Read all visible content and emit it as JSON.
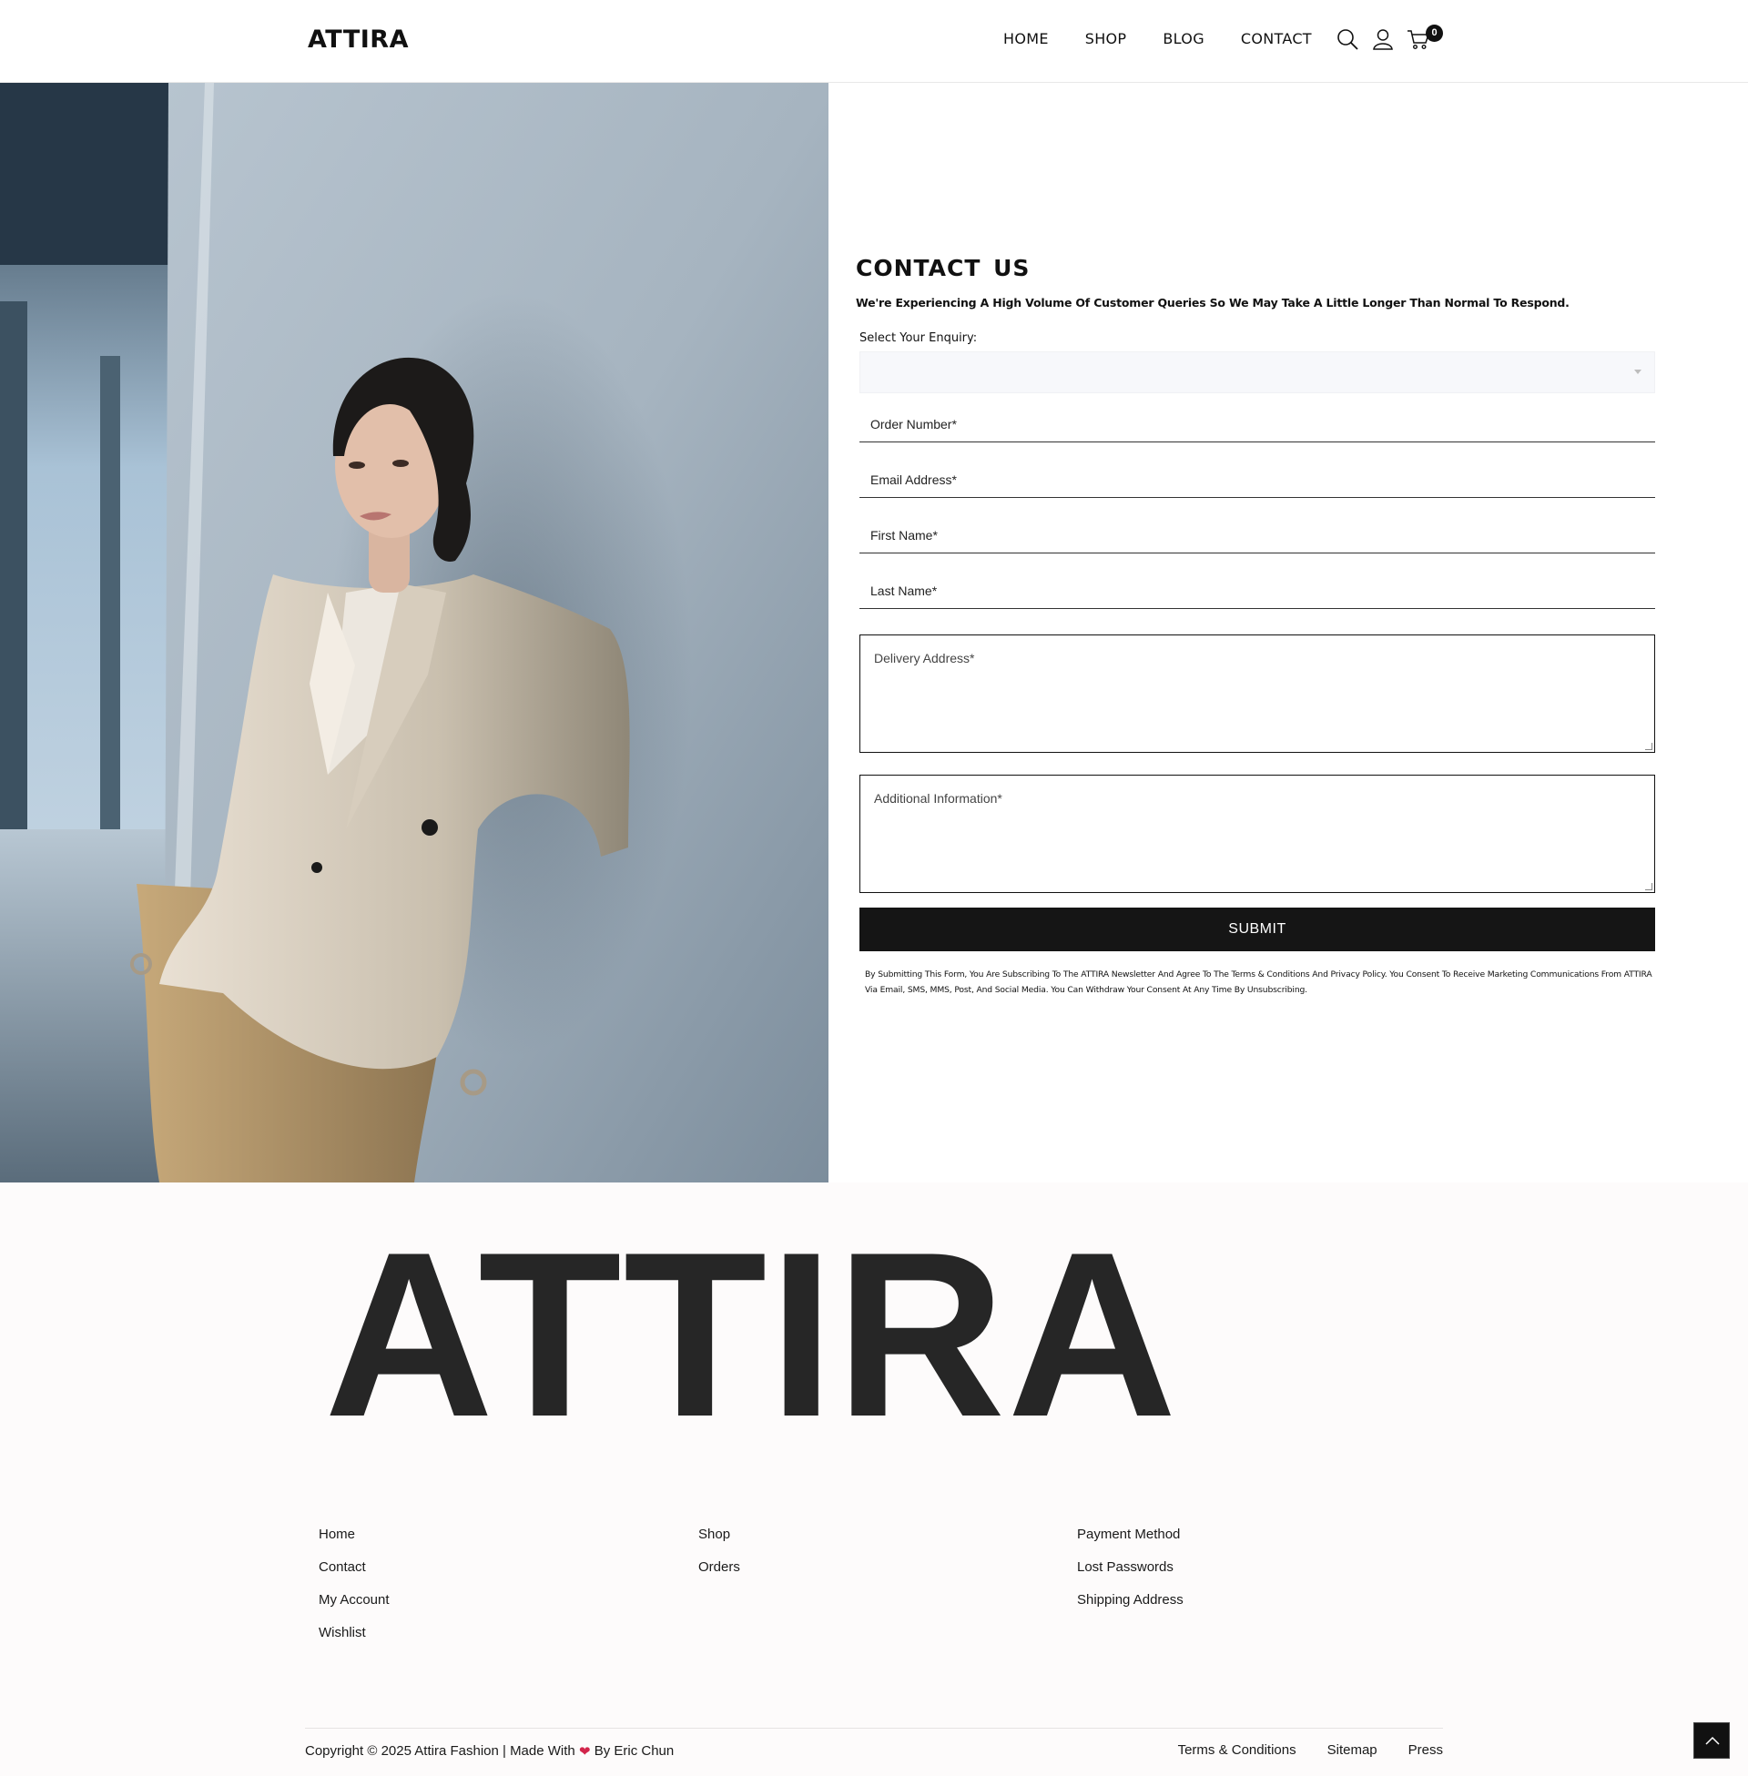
{
  "header": {
    "logo": "ATTIRA",
    "nav": [
      {
        "label": "HOME"
      },
      {
        "label": "SHOP"
      },
      {
        "label": "BLOG"
      },
      {
        "label": "CONTACT"
      }
    ],
    "cart_count": "0",
    "icons": [
      "search-icon",
      "user-icon",
      "cart-icon"
    ]
  },
  "hero": {
    "image": "woman-in-beige-blazer-photo"
  },
  "form": {
    "title": "CONTACT  US",
    "subtitle": "We're Experiencing A High Volume Of Customer Queries So We May Take A Little Longer Than Normal To Respond.",
    "enquiry_label": "Select Your Enquiry:",
    "enquiry_value": "",
    "fields": {
      "order_number": "Order Number*",
      "email": "Email Address*",
      "first_name": "First Name*",
      "last_name": "Last Name*",
      "delivery_address": "Delivery Address*",
      "additional_info": "Additional Information*"
    },
    "submit_label": "SUBMIT",
    "disclaimer": "By Submitting This Form, You Are Subscribing To The ATTIRA Newsletter And Agree To The Terms & Conditions And Privacy Policy. You Consent To Receive Marketing Communications From ATTIRA Via Email, SMS, MMS, Post, And Social Media. You Can Withdraw Your Consent At Any Time By Unsubscribing."
  },
  "brand_banner": "ATTIRA",
  "footer": {
    "col1": [
      "Home",
      "Contact",
      "My Account",
      "Wishlist"
    ],
    "col2": [
      "Shop",
      "Orders"
    ],
    "col3": [
      "Payment Method",
      "Lost Passwords",
      "Shipping Address"
    ],
    "copyright_prefix": "Copyright © 2025 Attira Fashion | Made With",
    "copyright_suffix": "By Eric Chun",
    "bottom_links": [
      "Terms & Conditions",
      "Sitemap",
      "Press"
    ]
  },
  "colors": {
    "accent": "#151515",
    "heart": "#d2254b",
    "select_bg": "#f7f8fb",
    "footer_bg": "#fdfbfb"
  }
}
